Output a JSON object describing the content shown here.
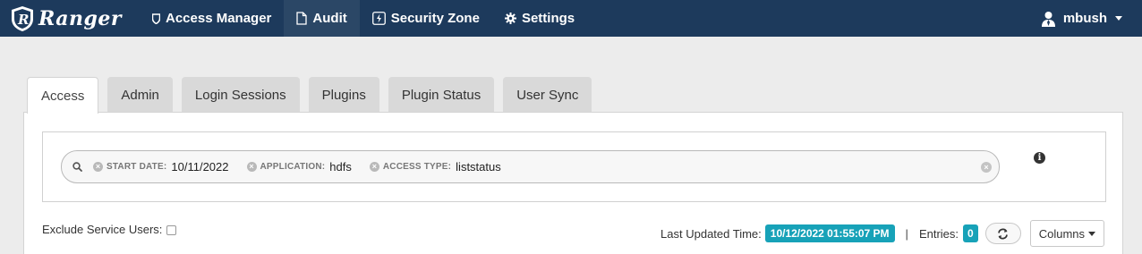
{
  "app": {
    "brand": "Ranger"
  },
  "nav": {
    "items": [
      {
        "label": "Access Manager",
        "icon": "shield-icon"
      },
      {
        "label": "Audit",
        "icon": "file-icon",
        "active": true
      },
      {
        "label": "Security Zone",
        "icon": "lightning-icon"
      },
      {
        "label": "Settings",
        "icon": "gear-icon"
      }
    ],
    "user": "mbush"
  },
  "tabs": [
    {
      "label": "Access",
      "active": true
    },
    {
      "label": "Admin"
    },
    {
      "label": "Login Sessions"
    },
    {
      "label": "Plugins"
    },
    {
      "label": "Plugin Status"
    },
    {
      "label": "User Sync"
    }
  ],
  "search": {
    "facets": [
      {
        "category": "START DATE:",
        "value": "10/11/2022"
      },
      {
        "category": "APPLICATION:",
        "value": "hdfs"
      },
      {
        "category": "ACCESS TYPE:",
        "value": "liststatus"
      }
    ]
  },
  "controls": {
    "exclude_label": "Exclude Service Users:",
    "exclude_checked": false,
    "last_updated_label": "Last Updated Time:",
    "last_updated_value": "10/12/2022 01:55:07 PM",
    "separator": "|",
    "entries_label": "Entries:",
    "entries_count": "0",
    "columns_label": "Columns"
  },
  "colors": {
    "navbar": "#1d3a5c",
    "badge": "#17a2b8",
    "background": "#ececec"
  }
}
